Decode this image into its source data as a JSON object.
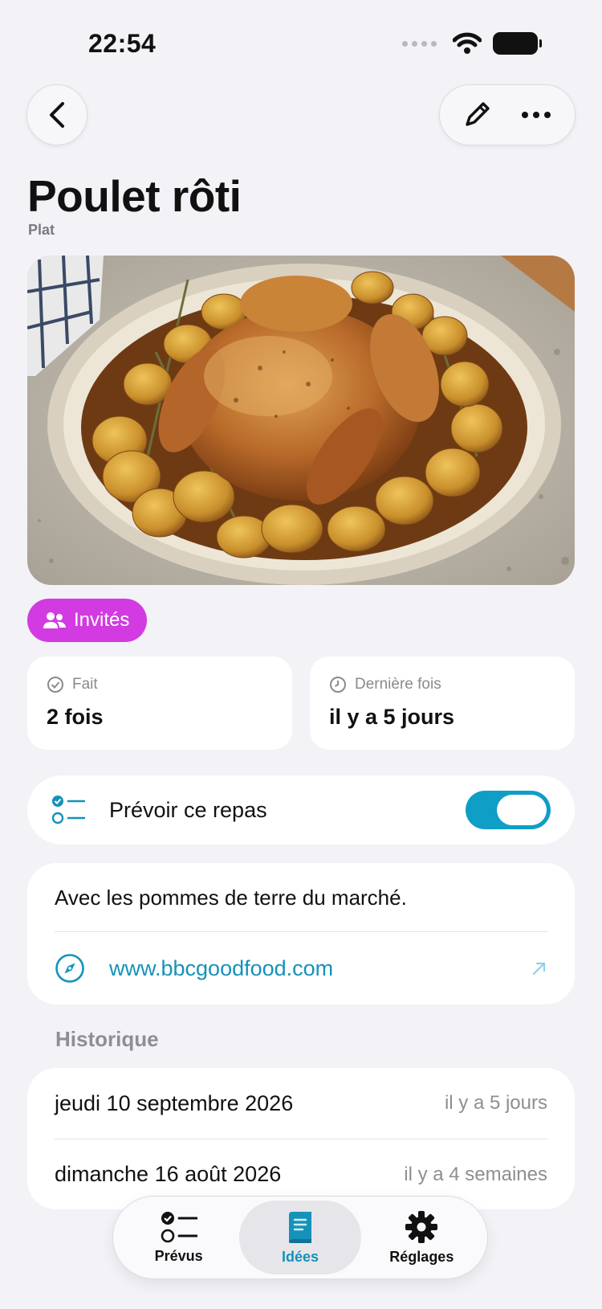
{
  "status_bar": {
    "time": "22:54"
  },
  "recipe": {
    "title": "Poulet rôti",
    "category": "Plat"
  },
  "badge": {
    "label": "Invités",
    "color": "#d23be1"
  },
  "stats": {
    "done": {
      "label": "Fait",
      "value": "2 fois"
    },
    "last": {
      "label": "Dernière fois",
      "value": "il y a 5 jours"
    }
  },
  "plan": {
    "label": "Prévoir ce repas",
    "enabled": true
  },
  "notes": {
    "text": "Avec les pommes de terre du marché.",
    "link": "www.bbcgoodfood.com"
  },
  "history": {
    "title": "Historique",
    "items": [
      {
        "date": "jeudi 10 septembre 2026",
        "relative": "il y a 5 jours"
      },
      {
        "date": "dimanche 16 août 2026",
        "relative": "il y a 4 semaines"
      }
    ]
  },
  "tabs": [
    {
      "label": "Prévus",
      "icon": "checklist-icon",
      "active": false
    },
    {
      "label": "Idées",
      "icon": "book-icon",
      "active": true
    },
    {
      "label": "Réglages",
      "icon": "gear-icon",
      "active": false
    }
  ],
  "colors": {
    "accent": "#1592b9",
    "toggle": "#0e9ec6",
    "badge": "#d23be1",
    "background": "#f2f2f7"
  },
  "icons": [
    "back-chevron-icon",
    "pencil-icon",
    "ellipsis-icon",
    "people-icon",
    "checkmark-circle-icon",
    "clock-icon",
    "checklist-icon",
    "compass-icon",
    "external-arrow-icon",
    "book-icon",
    "gear-icon"
  ]
}
